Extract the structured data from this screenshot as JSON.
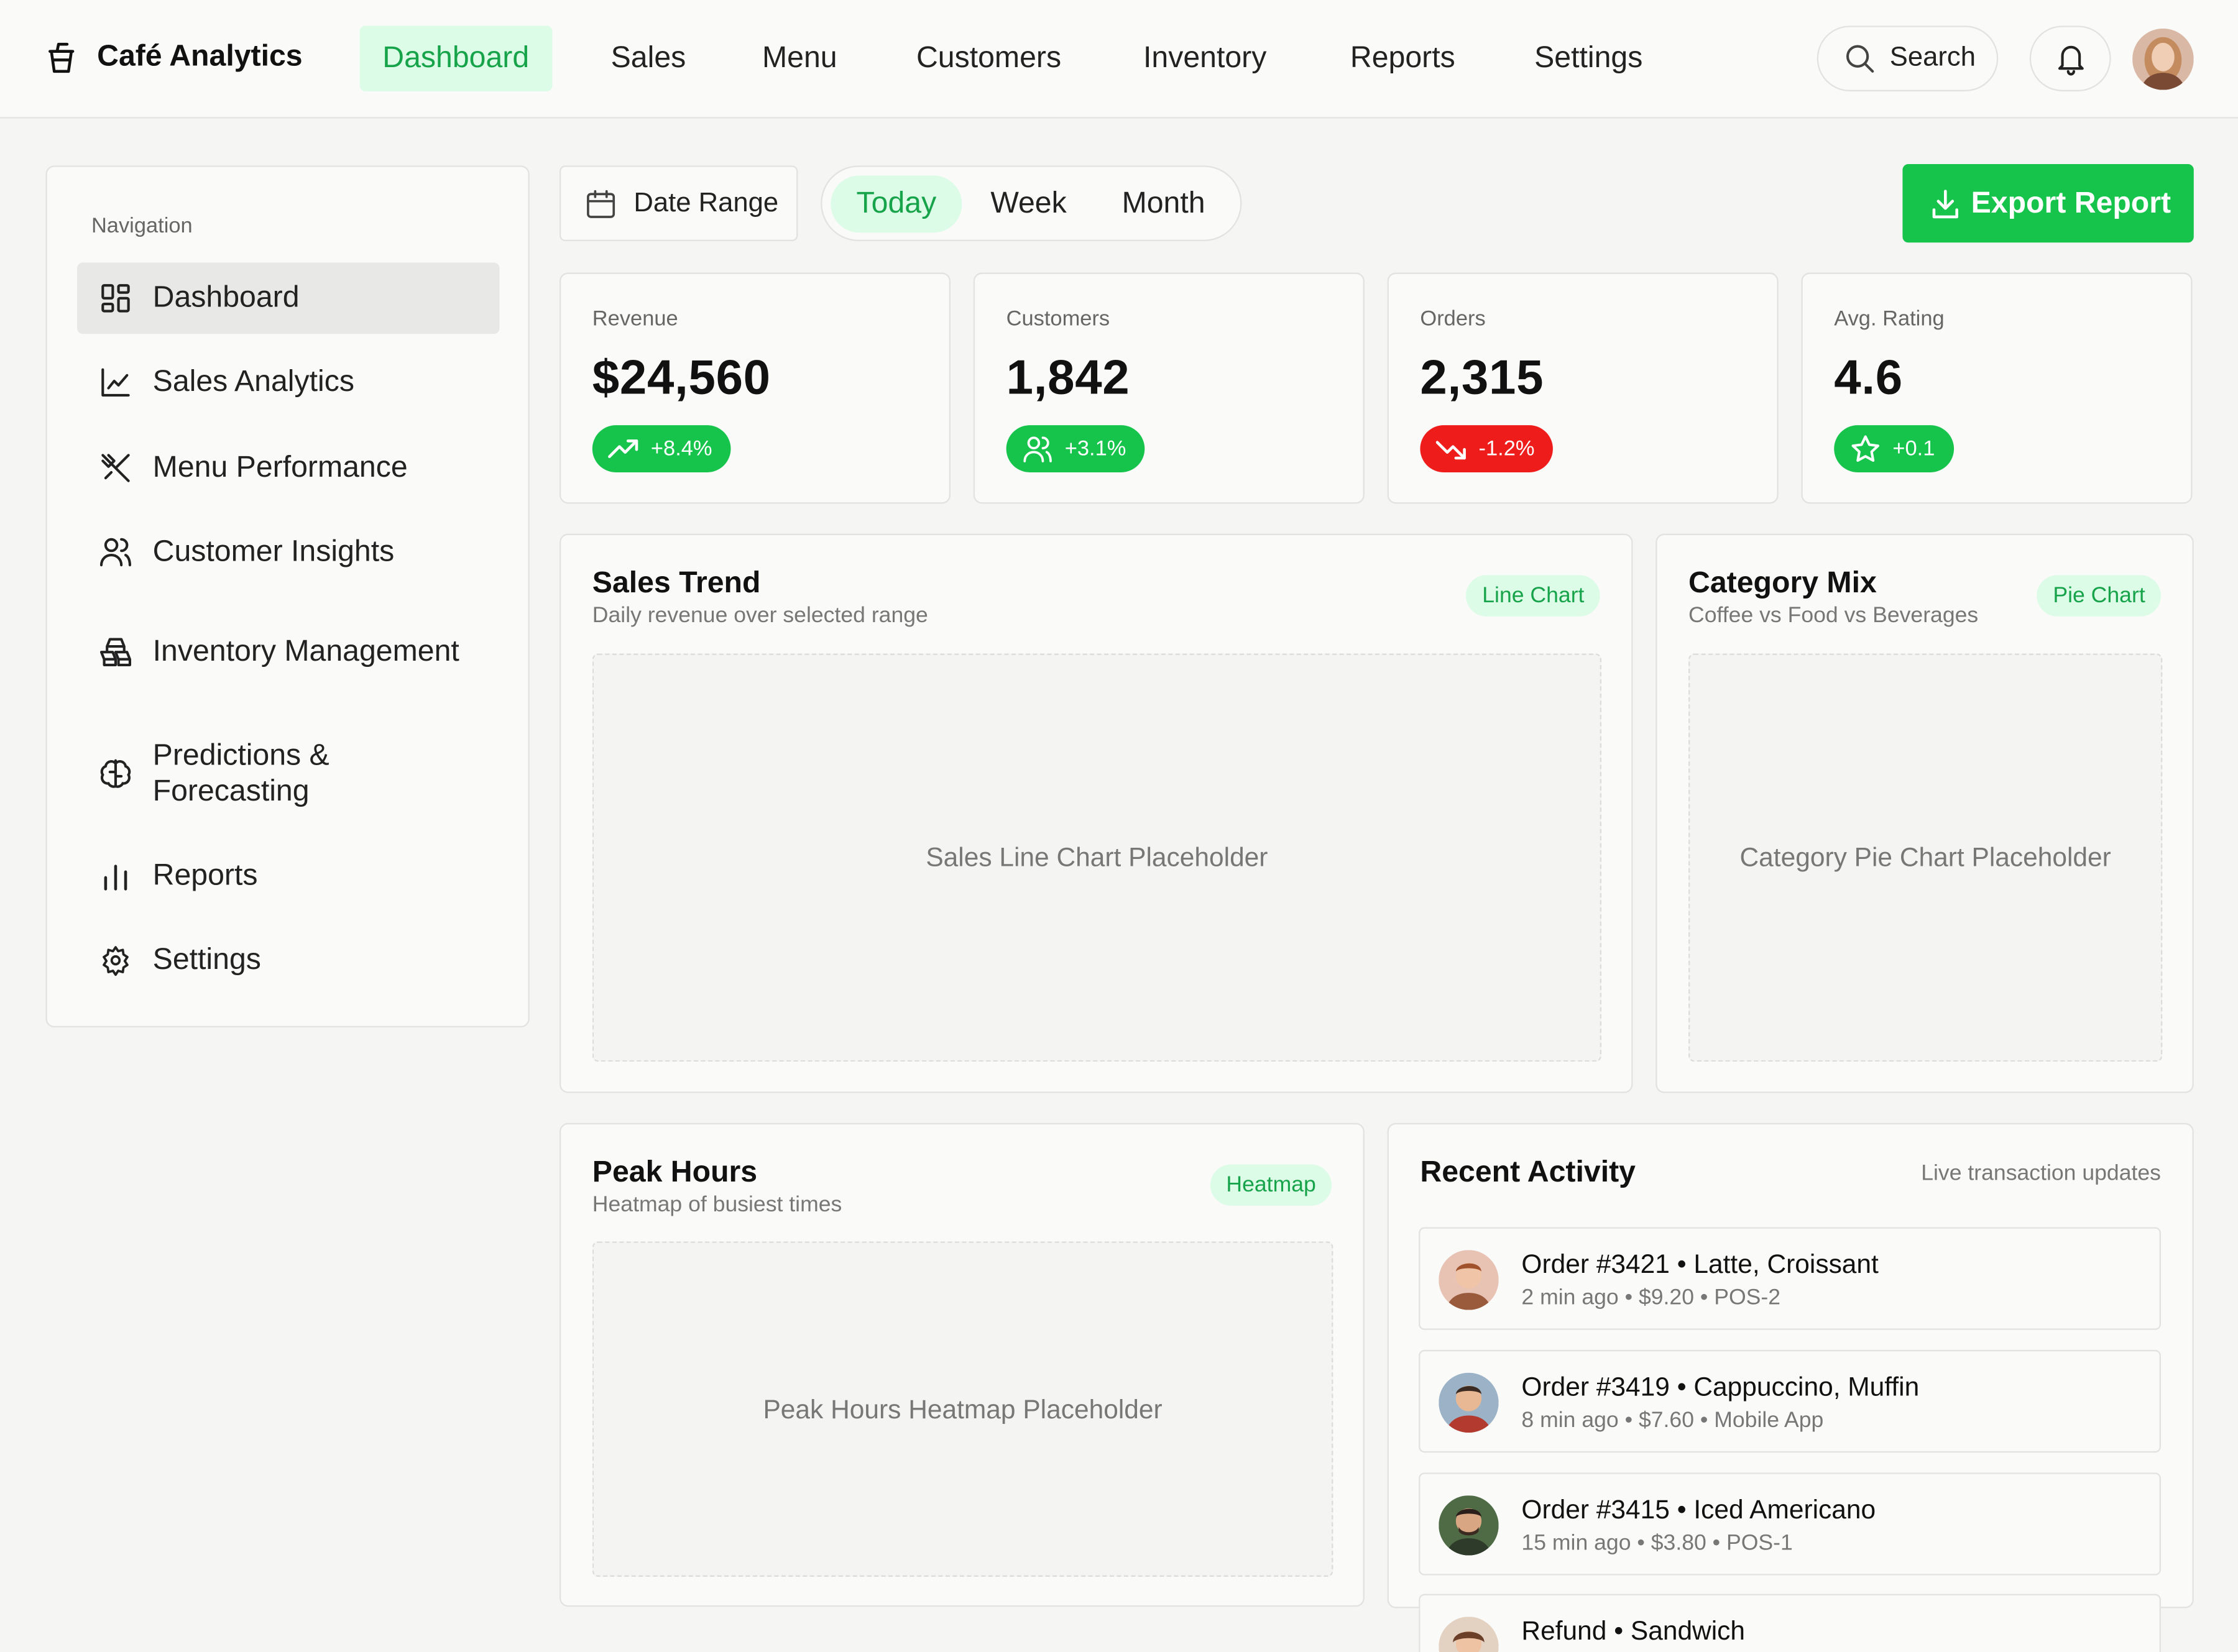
{
  "app": {
    "name": "Café Analytics",
    "icon": "cup-icon"
  },
  "topnav": {
    "items": [
      "Dashboard",
      "Sales",
      "Menu",
      "Customers",
      "Inventory",
      "Reports",
      "Settings"
    ],
    "active": "Dashboard",
    "search_label": "Search"
  },
  "sidebar": {
    "heading": "Navigation",
    "items": [
      {
        "label": "Dashboard",
        "icon": "dashboard-grid-icon"
      },
      {
        "label": "Sales Analytics",
        "icon": "line-chart-icon"
      },
      {
        "label": "Menu Performance",
        "icon": "utensils-crossed-icon"
      },
      {
        "label": "Customer Insights",
        "icon": "users-icon"
      },
      {
        "label": "Inventory Management",
        "icon": "boxes-icon"
      },
      {
        "label": "Predictions & Forecasting",
        "icon": "brain-icon"
      },
      {
        "label": "Reports",
        "icon": "bar-chart-icon"
      },
      {
        "label": "Settings",
        "icon": "gear-icon"
      }
    ],
    "active": "Dashboard"
  },
  "controls": {
    "date_range_label": "Date Range",
    "periods": [
      "Today",
      "Week",
      "Month"
    ],
    "active_period": "Today",
    "export_label": "Export Report"
  },
  "kpis": [
    {
      "label": "Revenue",
      "value": "$24,560",
      "change": "+8.4%",
      "trend": "up",
      "icon": "trending-up-icon"
    },
    {
      "label": "Customers",
      "value": "1,842",
      "change": "+3.1%",
      "trend": "up",
      "icon": "users-icon"
    },
    {
      "label": "Orders",
      "value": "2,315",
      "change": "-1.2%",
      "trend": "down",
      "icon": "trending-down-icon"
    },
    {
      "label": "Avg. Rating",
      "value": "4.6",
      "change": "+0.1",
      "trend": "up",
      "icon": "star-icon"
    }
  ],
  "panels": {
    "sales_trend": {
      "title": "Sales Trend",
      "subtitle": "Daily revenue over selected range",
      "tag": "Line Chart",
      "placeholder": "Sales Line Chart Placeholder"
    },
    "category_mix": {
      "title": "Category Mix",
      "subtitle": "Coffee vs Food vs Beverages",
      "tag": "Pie Chart",
      "placeholder": "Category Pie Chart Placeholder"
    },
    "peak_hours": {
      "title": "Peak Hours",
      "subtitle": "Heatmap of busiest times",
      "tag": "Heatmap",
      "placeholder": "Peak Hours Heatmap Placeholder"
    }
  },
  "activity": {
    "title": "Recent Activity",
    "subtitle": "Live transaction updates",
    "items": [
      {
        "title": "Order #3421 • Latte, Croissant",
        "meta": "2 min ago • $9.20 • POS-2"
      },
      {
        "title": "Order #3419 • Cappuccino, Muffin",
        "meta": "8 min ago • $7.60 • Mobile App"
      },
      {
        "title": "Order #3415 • Iced Americano",
        "meta": "15 min ago • $3.80 • POS-1"
      },
      {
        "title": "Refund • Sandwich",
        "meta": ""
      }
    ]
  },
  "colors": {
    "accent": "#16c44c",
    "accent_soft": "#dcfce7",
    "accent_text": "#16a34a",
    "negative": "#ef1c1c"
  }
}
